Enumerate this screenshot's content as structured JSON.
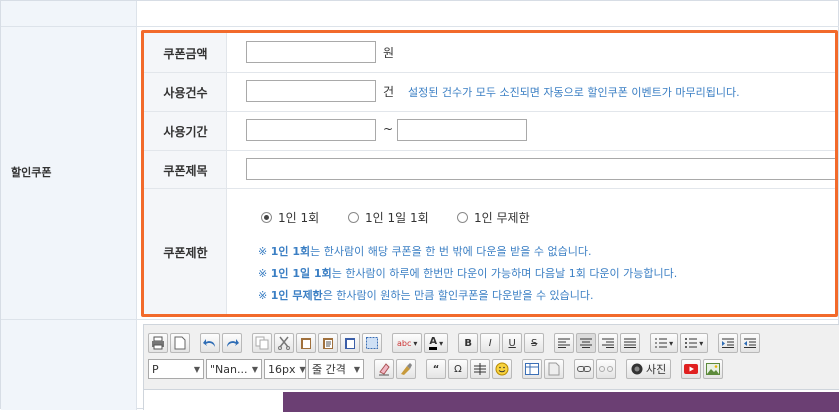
{
  "section_label": "할인쿠폰",
  "fields": {
    "amount": {
      "label": "쿠폰금액",
      "value": "",
      "unit": "원"
    },
    "count": {
      "label": "사용건수",
      "value": "",
      "unit": "건",
      "hint": "설정된 건수가 모두 소진되면 자동으로 할인쿠폰 이벤트가 마무리됩니다."
    },
    "period": {
      "label": "사용기간",
      "start": "",
      "end": "",
      "separator": "~"
    },
    "title": {
      "label": "쿠폰제목",
      "value": ""
    },
    "limit": {
      "label": "쿠폰제한",
      "options": [
        {
          "label": "1인 1회",
          "selected": true
        },
        {
          "label": "1인 1일 1회",
          "selected": false
        },
        {
          "label": "1인 무제한",
          "selected": false
        }
      ],
      "notes": [
        {
          "mark": "※",
          "bold": "1인 1회",
          "text": "는 한사람이 해당 쿠폰을 한 번 밖에 다운을 받을 수 없습니다."
        },
        {
          "mark": "※",
          "bold": "1인 1일 1회",
          "text": "는 한사람이 하루에 한번만 다운이 가능하며 다음날 1회 다운이 가능합니다."
        },
        {
          "mark": "※",
          "bold": "1인 무제한",
          "text": "은 한사람이 원하는 만큼 할인쿠폰을 다운받을 수 있습니다."
        }
      ]
    }
  },
  "editor": {
    "paragraph_select": "P",
    "font_select": "\"Nan...",
    "size_select": "16px",
    "line_spacing_select": "줄 간격",
    "format_bold": "B",
    "format_italic": "I",
    "format_underline": "U",
    "format_strike": "S",
    "quote": "“",
    "omega": "Ω",
    "photo_label": "사진",
    "abc": "abc",
    "text_color": "A"
  },
  "colors": {
    "highlight_border": "#f26a2b",
    "hint_text": "#3b7fc4",
    "editor_block": "#6b3f73"
  }
}
